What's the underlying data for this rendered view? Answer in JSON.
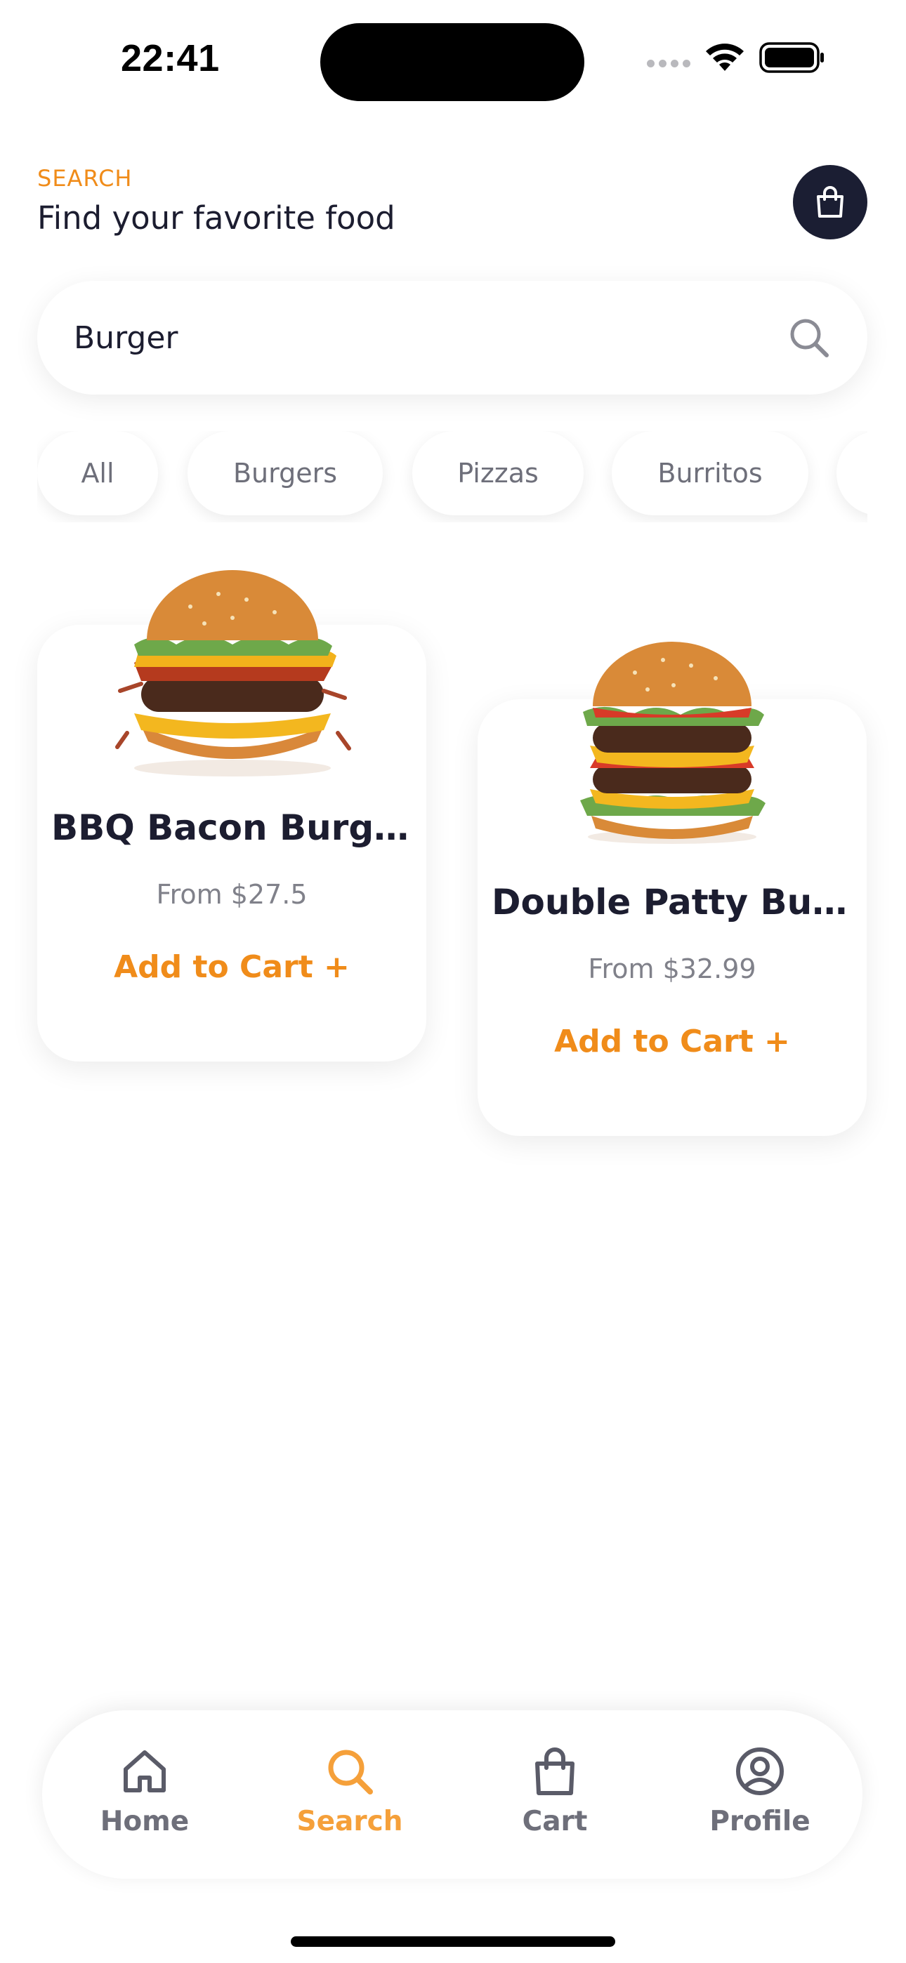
{
  "status_bar": {
    "time": "22:41"
  },
  "header": {
    "eyebrow": "SEARCH",
    "title": "Find your favorite food"
  },
  "search": {
    "value": "Burger",
    "placeholder": ""
  },
  "categories": [
    {
      "label": "All"
    },
    {
      "label": "Burgers"
    },
    {
      "label": "Pizzas"
    },
    {
      "label": "Burritos"
    }
  ],
  "products": [
    {
      "name": "BBQ Bacon Burger",
      "price": "From $27.5",
      "cta": "Add to Cart +"
    },
    {
      "name": "Double Patty Bur…",
      "price": "From $32.99",
      "cta": "Add to Cart +"
    }
  ],
  "nav": {
    "items": [
      {
        "label": "Home",
        "icon": "home-icon"
      },
      {
        "label": "Search",
        "icon": "search-icon"
      },
      {
        "label": "Cart",
        "icon": "bag-icon"
      },
      {
        "label": "Profile",
        "icon": "user-icon"
      }
    ],
    "active": "Search"
  },
  "colors": {
    "accent": "#f08c1a",
    "dark": "#1b1e33",
    "muted": "#6e6f7a"
  }
}
